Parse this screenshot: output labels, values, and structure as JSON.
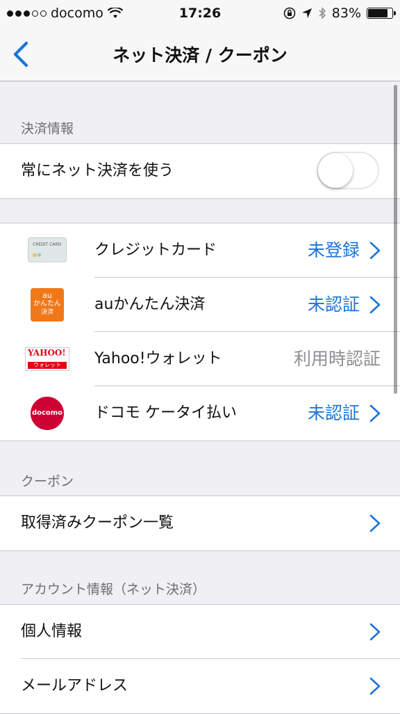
{
  "status_bar": {
    "carrier": "docomo",
    "time": "17:26",
    "battery_percent": "83%",
    "battery_level": 0.83,
    "signal_bars_filled": 3,
    "signal_bars_total": 5
  },
  "nav": {
    "title": "ネット決済 / クーポン",
    "back_icon": "chevron-left-icon"
  },
  "sections": {
    "payment_info": {
      "header": "決済情報",
      "always_use_label": "常にネット決済を使う",
      "always_use_on": false
    },
    "payment_methods": [
      {
        "label": "クレジットカード",
        "status": "未登録",
        "logo_text": "CREDIT CARD"
      },
      {
        "label": "auかんたん決済",
        "status": "未認証",
        "logo_lines": [
          "au",
          "かんたん",
          "決済"
        ]
      },
      {
        "label": "Yahoo!ウォレット",
        "status": "利用時認証",
        "logo_lines": [
          "YAHOO!",
          "ウォレット"
        ]
      },
      {
        "label": "ドコモ ケータイ払い",
        "status": "未認証",
        "logo_text": "docomo"
      }
    ],
    "coupon": {
      "header": "クーポン",
      "acquired_label": "取得済みクーポン一覧"
    },
    "account": {
      "header": "アカウント情報（ネット決済）",
      "personal_label": "個人情報",
      "email_label": "メールアドレス"
    }
  },
  "colors": {
    "accent": "#1a74d9",
    "background": "#efeff4",
    "secondary_text": "#8e8e93"
  }
}
